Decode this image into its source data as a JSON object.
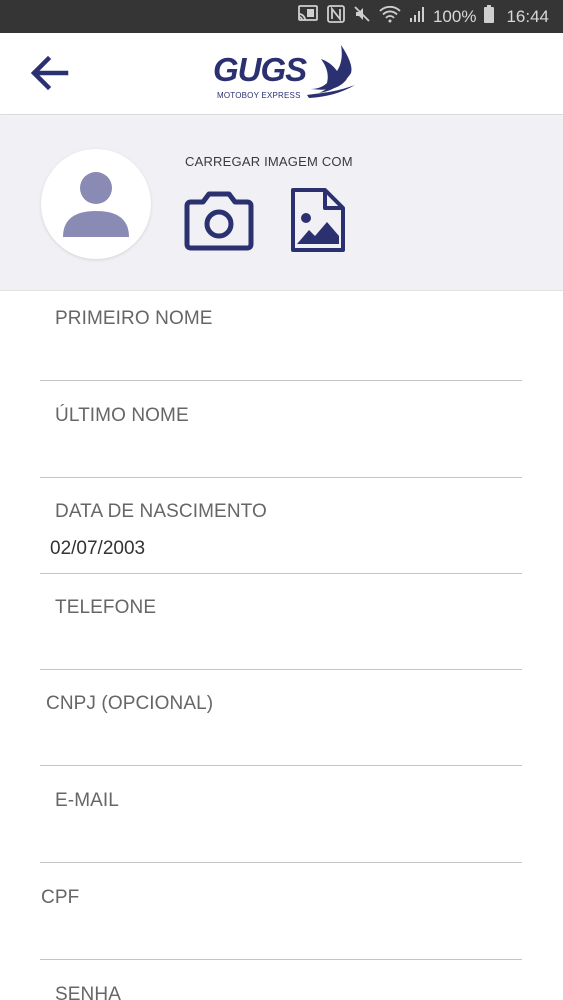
{
  "status_bar": {
    "battery": "100%",
    "time": "16:44"
  },
  "header": {
    "logo_text": "GUGS",
    "logo_subtitle": "MOTOBOY EXPRESS"
  },
  "photo": {
    "upload_label": "CARREGAR IMAGEM COM"
  },
  "form": {
    "first_name": {
      "label": "PRIMEIRO NOME",
      "value": ""
    },
    "last_name": {
      "label": "ÚLTIMO NOME",
      "value": ""
    },
    "birth_date": {
      "label": "DATA DE NASCIMENTO",
      "value": "02/07/2003"
    },
    "phone": {
      "label": "TELEFONE",
      "value": ""
    },
    "cnpj": {
      "label": "CNPJ (OPCIONAL)",
      "value": ""
    },
    "email": {
      "label": "E-MAIL",
      "value": ""
    },
    "cpf": {
      "label": "CPF",
      "value": ""
    },
    "password": {
      "label": "SENHA",
      "value": ""
    }
  },
  "colors": {
    "brand": "#2b3170",
    "avatar_icon": "#8a8bb5",
    "status_bar": "#353535",
    "photo_bg": "#f1f0f4"
  }
}
